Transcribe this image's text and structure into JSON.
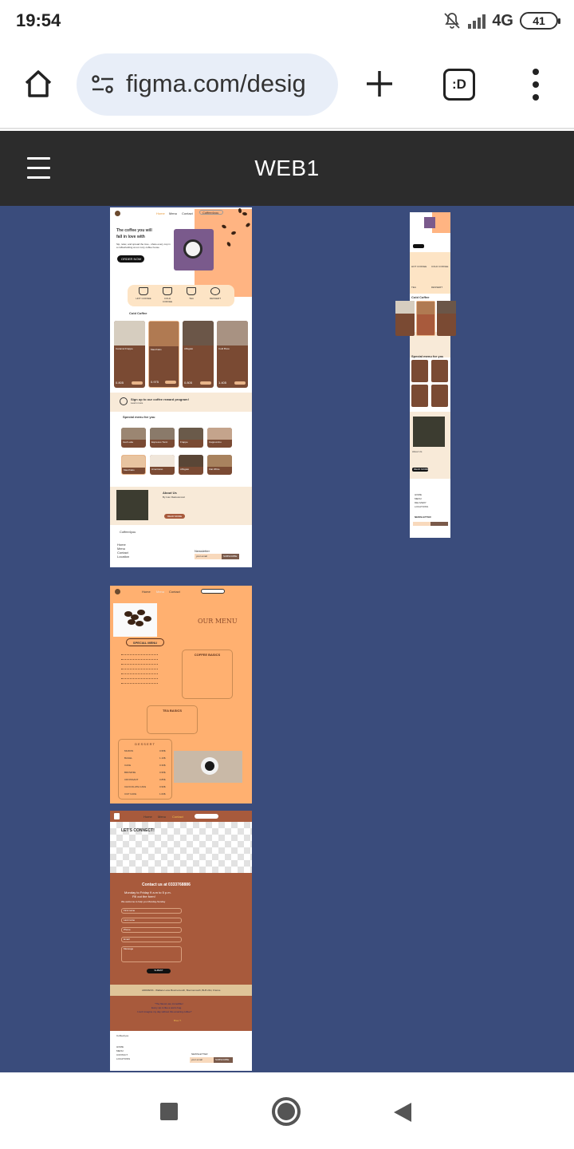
{
  "status_bar": {
    "time": "19:54",
    "network": "4G",
    "battery": "41"
  },
  "browser": {
    "url": "figma.com/desig",
    "tabs_label": ":D"
  },
  "figma": {
    "title": "WEB1"
  },
  "frame_home": {
    "nav": [
      "Home",
      "Menu",
      "Contact"
    ],
    "search": "Coffee4you",
    "hero_line1": "The coffee you will",
    "hero_line2": "fall in love with",
    "hero_sub": "Sip, relax, and spread the love - share every cup in a coffeeholding at our cozy coffee house",
    "hero_button": "ORDER NOW",
    "categories": [
      "HOT COFFEE",
      "COLD COFFEE",
      "TEA",
      "DESSERT"
    ],
    "cold_title": "Cold Coffee",
    "cold_items": [
      {
        "name": "Caramel Frappe",
        "price": "0.805",
        "button": "ADD TO CART"
      },
      {
        "name": "Macchiato",
        "price": "0.975",
        "button": "ORDER NOW"
      },
      {
        "name": "Affogato",
        "price": "0.805",
        "button": "ORDER NOW"
      },
      {
        "name": "Cold Brew",
        "price": "1.405",
        "button": "ORDER NOW"
      }
    ],
    "signup_text": "Sign up to our coffee reward program!",
    "signup_sub": "Learn more",
    "special_title": "Special menu for you",
    "special_items": [
      "Iced Latte",
      "Espresso Tonic",
      "Frappe",
      "Cappuccino",
      "Macchiato",
      "Americano",
      "Affogato",
      "Flat White"
    ],
    "about_title": "About Us",
    "about_sub": "By Ivan Radovanovic",
    "about_button": "READ MORE",
    "footer_brand": "Coffee4you",
    "footer_links": [
      "Home",
      "Menu",
      "Contact",
      "Location"
    ],
    "newsletter_label": "Newsletter",
    "newsletter_placeholder": "your email",
    "newsletter_button": "SUBSCRIBE"
  },
  "frame_mobile": {
    "categories": [
      "HOT COFFEE",
      "COLD COFFEE",
      "TEA",
      "DESSERT"
    ],
    "cold_title": "Cold Coffee",
    "special_title": "Special menu for you",
    "about_title": "About Us",
    "about_button": "READ MORE",
    "footer_links": [
      "HOME",
      "MENU",
      "DELIVERY",
      "LOCATIONS"
    ],
    "newsletter_label": "NEWSLETTER"
  },
  "frame_menu": {
    "nav": [
      "Home",
      "Menu",
      "Contact"
    ],
    "title": "OUR MENU",
    "special_menu": "SPECIAL MENU",
    "coffee_basics": "COFFEE BASICS",
    "tea_basics": "TEA BASICS",
    "dessert": "DESSERT",
    "dessert_items": [
      {
        "name": "MUFFIN",
        "price": "0.95$"
      },
      {
        "name": "BAGEL",
        "price": "1.10$"
      },
      {
        "name": "CAKE",
        "price": "0.30$"
      },
      {
        "name": "BROWNIE",
        "price": "0.95$"
      },
      {
        "name": "CROISSANT",
        "price": "0.85$"
      },
      {
        "name": "CHOCOLATE CAKE",
        "price": "0.90$"
      },
      {
        "name": "CUP CAKE",
        "price": "1.00$"
      }
    ]
  },
  "frame_contact": {
    "nav": [
      "Home",
      "Menu",
      "Contact"
    ],
    "lets_connect": "LET'S CONNECT!",
    "contact_title": "Contact us at 0333768886",
    "hours_line1": "Monday to Friday 9 a.m to 5 p.m.",
    "hours_line2": "Fill out the form!",
    "hours_line3": "We welcome to help you Monday-Sunday",
    "fields": [
      "First name",
      "Last name",
      "Phone",
      "Email",
      "Message"
    ],
    "submit": "SUBMIT",
    "address": "ADDRESS - Wallace Lane Bournemouth, Bournemouth, BH5 2JH, France",
    "quote_line1": "\"The flavors are incredible!",
    "quote_line2": "Every sip is like a warm hug.",
    "quote_line3": "I can't imagine my day without this amazing coffee!\"",
    "quote_author": "Bree T.",
    "footer_brand": "Coffee4you",
    "footer_links": [
      "HOME",
      "MENU",
      "CONTACT",
      "LOCATIONS"
    ],
    "newsletter_label": "NEWSLETTER",
    "newsletter_placeholder": "your email",
    "newsletter_button": "SUBSCRIBE"
  },
  "android_nav": {
    "icons": [
      "recents-square-icon",
      "home-circle-icon",
      "back-triangle-icon"
    ]
  },
  "colors": {
    "figma_header": "#2c2c2c",
    "canvas": "#3a4c7c",
    "peach": "#ffb070",
    "brown": "#a85a3c",
    "dark_brown": "#7a4a33"
  }
}
